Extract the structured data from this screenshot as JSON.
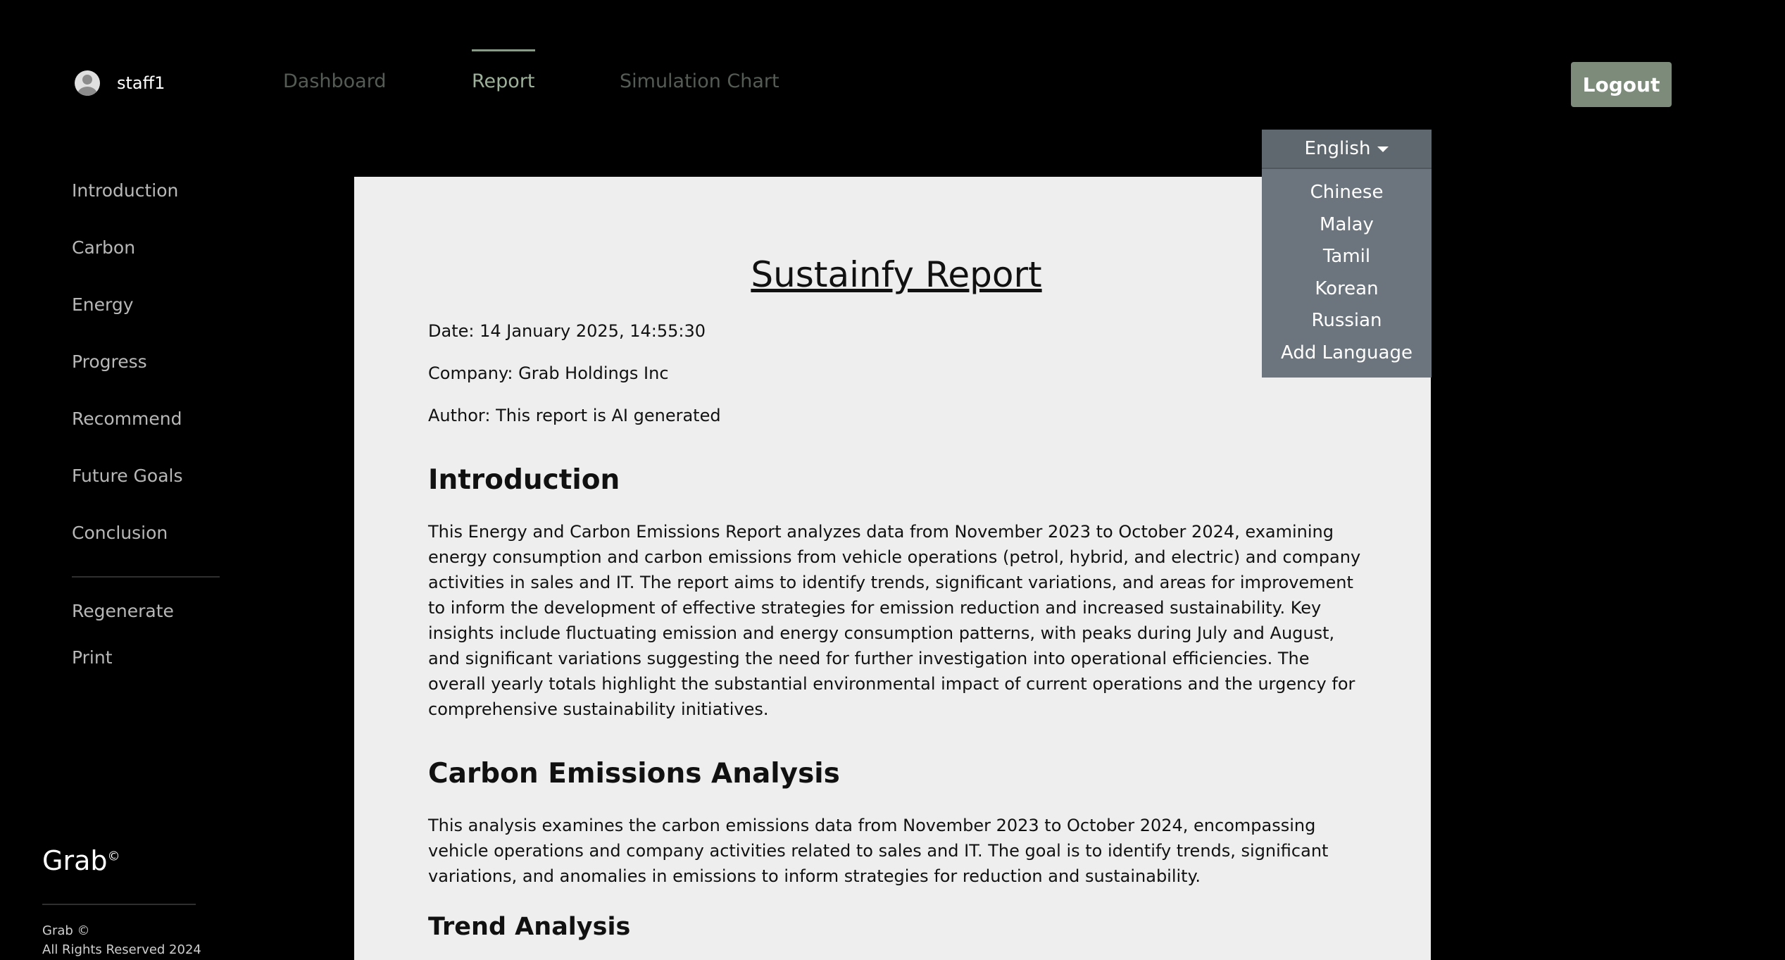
{
  "header": {
    "username": "staff1",
    "tabs": [
      {
        "label": "Dashboard"
      },
      {
        "label": "Report"
      },
      {
        "label": "Simulation Chart"
      }
    ],
    "logout_label": "Logout"
  },
  "sidebar": {
    "items": [
      {
        "label": "Introduction"
      },
      {
        "label": "Carbon"
      },
      {
        "label": "Energy"
      },
      {
        "label": "Progress"
      },
      {
        "label": "Recommend"
      },
      {
        "label": "Future Goals"
      },
      {
        "label": "Conclusion"
      }
    ],
    "actions": [
      {
        "label": "Regenerate"
      },
      {
        "label": "Print"
      }
    ]
  },
  "brand": {
    "name": "Grab",
    "mark": "©",
    "footer_line1": "Grab ©",
    "footer_line2": "All Rights Reserved 2024"
  },
  "language": {
    "selected": "English",
    "options": [
      "Chinese",
      "Malay",
      "Tamil",
      "Korean",
      "Russian",
      "Add Language"
    ]
  },
  "report": {
    "title": "Sustainfy Report",
    "date": "Date: 14 January 2025, 14:55:30",
    "company": "Company: Grab Holdings Inc",
    "author": "Author: This report is AI generated",
    "intro_heading": "Introduction",
    "intro_text": "This Energy and Carbon Emissions Report analyzes data from November 2023 to October 2024, examining energy consumption and carbon emissions from vehicle operations (petrol, hybrid, and electric) and company activities in sales and IT. The report aims to identify trends, significant variations, and areas for improvement to inform the development of effective strategies for emission reduction and increased sustainability. Key insights include fluctuating emission and energy consumption patterns, with peaks during July and August, and significant variations suggesting the need for further investigation into operational efficiencies. The overall yearly totals highlight the substantial environmental impact of current operations and the urgency for comprehensive sustainability initiatives.",
    "carbon_heading": "Carbon Emissions Analysis",
    "carbon_text": "This analysis examines the carbon emissions data from November 2023 to October 2024, encompassing vehicle operations and company activities related to sales and IT. The goal is to identify trends, significant variations, and anomalies in emissions to inform strategies for reduction and sustainability.",
    "trend_heading": "Trend Analysis"
  },
  "colors": {
    "background": "#000000",
    "paper": "#eeeeee",
    "accent": "#7c8b7a",
    "dropdown": "#6c757d"
  }
}
